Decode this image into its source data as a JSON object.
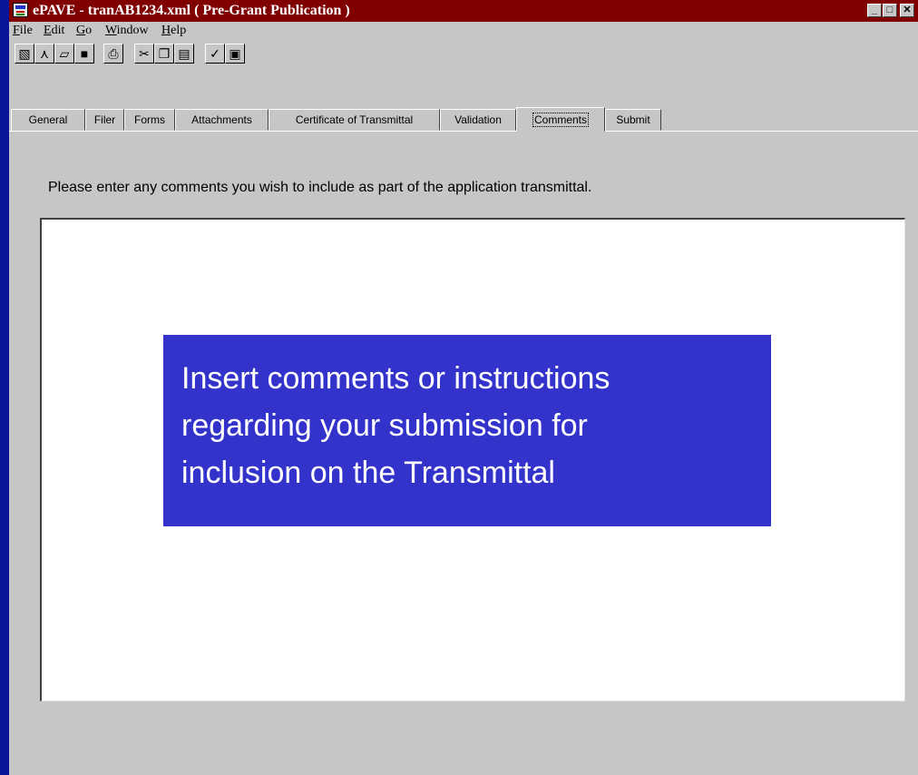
{
  "window": {
    "title": "ePAVE - tranAB1234.xml ( Pre-Grant Publication )",
    "buttons": {
      "minimize": "_",
      "maximize": "□",
      "close": "✕"
    }
  },
  "menu": [
    "File",
    "Edit",
    "Go",
    "Window",
    "Help"
  ],
  "toolbar": [
    {
      "icon": "new-document-icon",
      "glyph": "▧"
    },
    {
      "icon": "compass-icon",
      "glyph": "⋏"
    },
    {
      "icon": "open-folder-icon",
      "glyph": "▱"
    },
    {
      "icon": "save-disk-icon",
      "glyph": "■"
    },
    {
      "icon": "print-icon",
      "glyph": "⎙"
    },
    {
      "icon": "cut-icon",
      "glyph": "✂"
    },
    {
      "icon": "copy-icon",
      "glyph": "❐"
    },
    {
      "icon": "paste-icon",
      "glyph": "▤"
    },
    {
      "icon": "validate-check-icon",
      "glyph": "✓"
    },
    {
      "icon": "submit-icon",
      "glyph": "▣"
    }
  ],
  "tabs": [
    {
      "label": "General",
      "active": false
    },
    {
      "label": "Filer",
      "active": false
    },
    {
      "label": "Forms",
      "active": false
    },
    {
      "label": "Attachments",
      "active": false
    },
    {
      "label": "Certificate of Transmittal",
      "active": false
    },
    {
      "label": "Validation",
      "active": false
    },
    {
      "label": "Comments",
      "active": true
    },
    {
      "label": "Submit",
      "active": false
    }
  ],
  "instruction": "Please enter any comments you wish to include as part of the application transmittal.",
  "comments_value": "",
  "callout": {
    "lines": [
      "Insert comments or instructions",
      "regarding your submission for",
      "inclusion on the Transmittal"
    ]
  },
  "colors": {
    "desktop": "#0a1496",
    "titlebar": "#800000",
    "callout": "#3333cc",
    "panel": "#c6c6c6"
  }
}
